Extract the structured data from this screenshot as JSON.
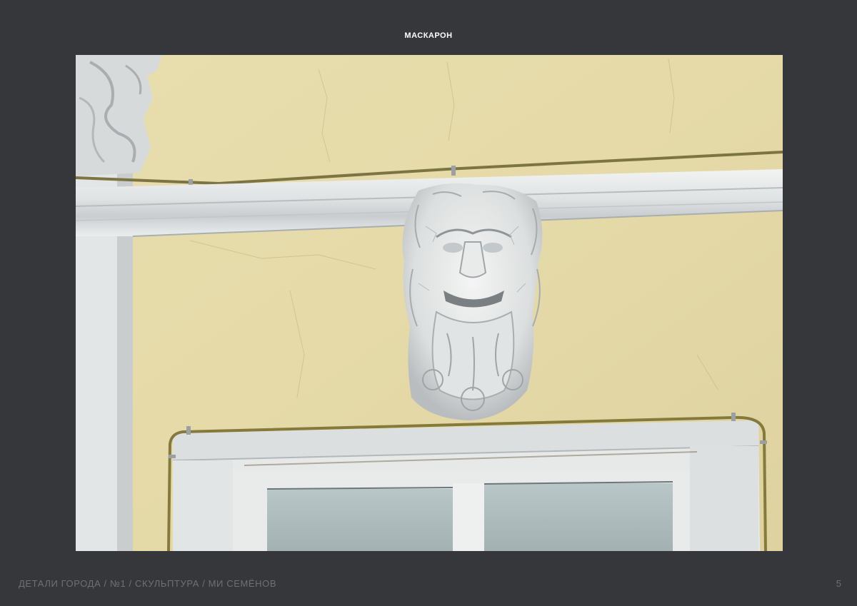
{
  "page": {
    "title": "МАСКАРОН",
    "footer": "ДЕТАЛИ ГОРОДА / №1 / СКУЛЬПТУРА / МИ СЕМЁНОВ",
    "page_number": "5"
  },
  "photo": {
    "subject": "lion-head-mascaron"
  },
  "colors": {
    "background": "#35373b",
    "wall": "#e6dcaa",
    "stucco": "#e4e6e6",
    "footer_text": "#6e7076"
  }
}
